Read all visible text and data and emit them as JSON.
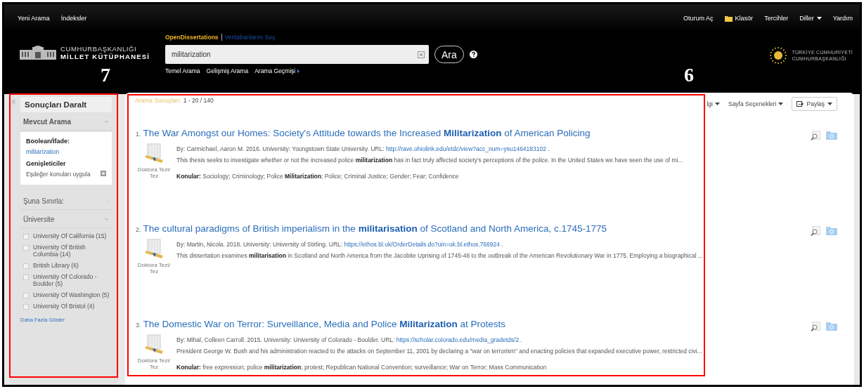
{
  "top_nav": {
    "left": [
      {
        "label": "Yeni Arama"
      },
      {
        "label": "İndeksler"
      }
    ],
    "right": [
      {
        "label": "Oturum Aç",
        "kind": "link"
      },
      {
        "label": "Klasör",
        "kind": "folder"
      },
      {
        "label": "Tercihler",
        "kind": "link"
      },
      {
        "label": "Diller",
        "kind": "dropdown"
      },
      {
        "label": "Yardım",
        "kind": "link"
      }
    ]
  },
  "logo": {
    "line1": "CUMHURBAŞKANLIĞI",
    "line2": "MİLLET KÜTÜPHANESİ"
  },
  "search": {
    "database": "OpenDissertations",
    "database_link": "Veritabanlarını Seç",
    "value": "militarization",
    "button": "Ara",
    "links": [
      {
        "label": "Temel Arama"
      },
      {
        "label": "Gelişmiş Arama"
      },
      {
        "label": "Arama Geçmişi",
        "arrow": true
      }
    ]
  },
  "partner_logo": {
    "line1": "TÜRKİYE CUMHURİYETİ",
    "line2": "CUMHURBAŞKANLIĞI"
  },
  "sidebar": {
    "title": "Sonuçları Daralt",
    "current_search": {
      "heading": "Mevcut Arama",
      "boolean_label": "Boolean/İfade:",
      "boolean_value": "militarization",
      "expanders_label": "Genişleticiler",
      "expander": "Eşdeğer konuları uygula"
    },
    "limit_heading": "Şuna Sınırla:",
    "facet": {
      "heading": "Üniversite",
      "options": [
        {
          "label": "University Of California (15)",
          "checked": false
        },
        {
          "label": "University Of British Columbia (14)",
          "checked": false
        },
        {
          "label": "British Library (6)",
          "checked": false
        },
        {
          "label": "University Of Colorado - Boulder (5)",
          "checked": false
        },
        {
          "label": "University Of Washington (5)",
          "checked": false
        },
        {
          "label": "University Of Bristol (4)",
          "checked": false
        }
      ]
    },
    "more_link": "Daha Fazla Göster"
  },
  "results": {
    "label": "Arama Sonuçları:",
    "range": "1 - 20 / 140",
    "toolbar": [
      {
        "label": "lgi",
        "kind": "dropdown"
      },
      {
        "label": "Sayfa Seçenekleri",
        "kind": "dropdown"
      },
      {
        "label": "Paylaş",
        "kind": "share"
      }
    ],
    "items": [
      {
        "number": "1.",
        "title": "The War Amongst our Homes: Society's Attitude towards the Increased **Militarization** of American Policing",
        "meta": "By: Carmichael, Aaron M. 2016. University: Youngstown State University. URL:",
        "url": "http://rave.ohiolink.edu/etdc/view?acc_num=ysu1464183102",
        "meta_end": ".",
        "description": "This thesis seeks to investigate whether or not the increased police **militarization** has in fact truly affected society's perceptions of the police. In the United States we have seen the use of mi...",
        "subjects_label": "Konular:",
        "subjects": "Sociology; Criminology; Police **Militarization**; Police; Criminal Justice; Gender; Fear; Confidence",
        "type": "Doktora Tezi/ Tez"
      },
      {
        "number": "2.",
        "title": "The cultural paradigms of British imperialism in the **militarisation** of Scotland and North America, c.1745-1775",
        "meta": "By: Martin, Nicola. 2018. University: University of Stirling. URL:",
        "url": "https://ethos.bl.uk/OrderDetails.do?uin=uk.bl.ethos.766924",
        "meta_end": ".",
        "description": "This dissertation examines **militarisation** in Scotland and North America from the Jacobite Uprising of 1745-46 to the outbreak of the American Revolutionary War in 1775. Employing a biographical ...",
        "type": "Doktora Tezi/ Tez"
      },
      {
        "number": "3.",
        "title": "The Domestic War on Terror: Surveillance, Media and Police **Militarization** at Protests",
        "meta": "By: Mihal, Colleen Carroll. 2015. University: University of Colorado - Boulder. URL:",
        "url": "https://scholar.colorado.edu/media_gradetds/2",
        "meta_end": ".",
        "description": "President George W. Bush and his administration reacted to the attacks on September 11, 2001 by declaring a \"war on terrorism\" and enacting policies that expanded executive power, restricted civi...",
        "subjects_label": "Konular:",
        "subjects": "free expression; police **militarization**; protest; Republican National Convention; surveillance; War on Terror; Mass Communication",
        "type": "Doktora Tezi/ Tez"
      }
    ]
  },
  "annotations": [
    {
      "label": "7"
    },
    {
      "label": "6"
    }
  ]
}
